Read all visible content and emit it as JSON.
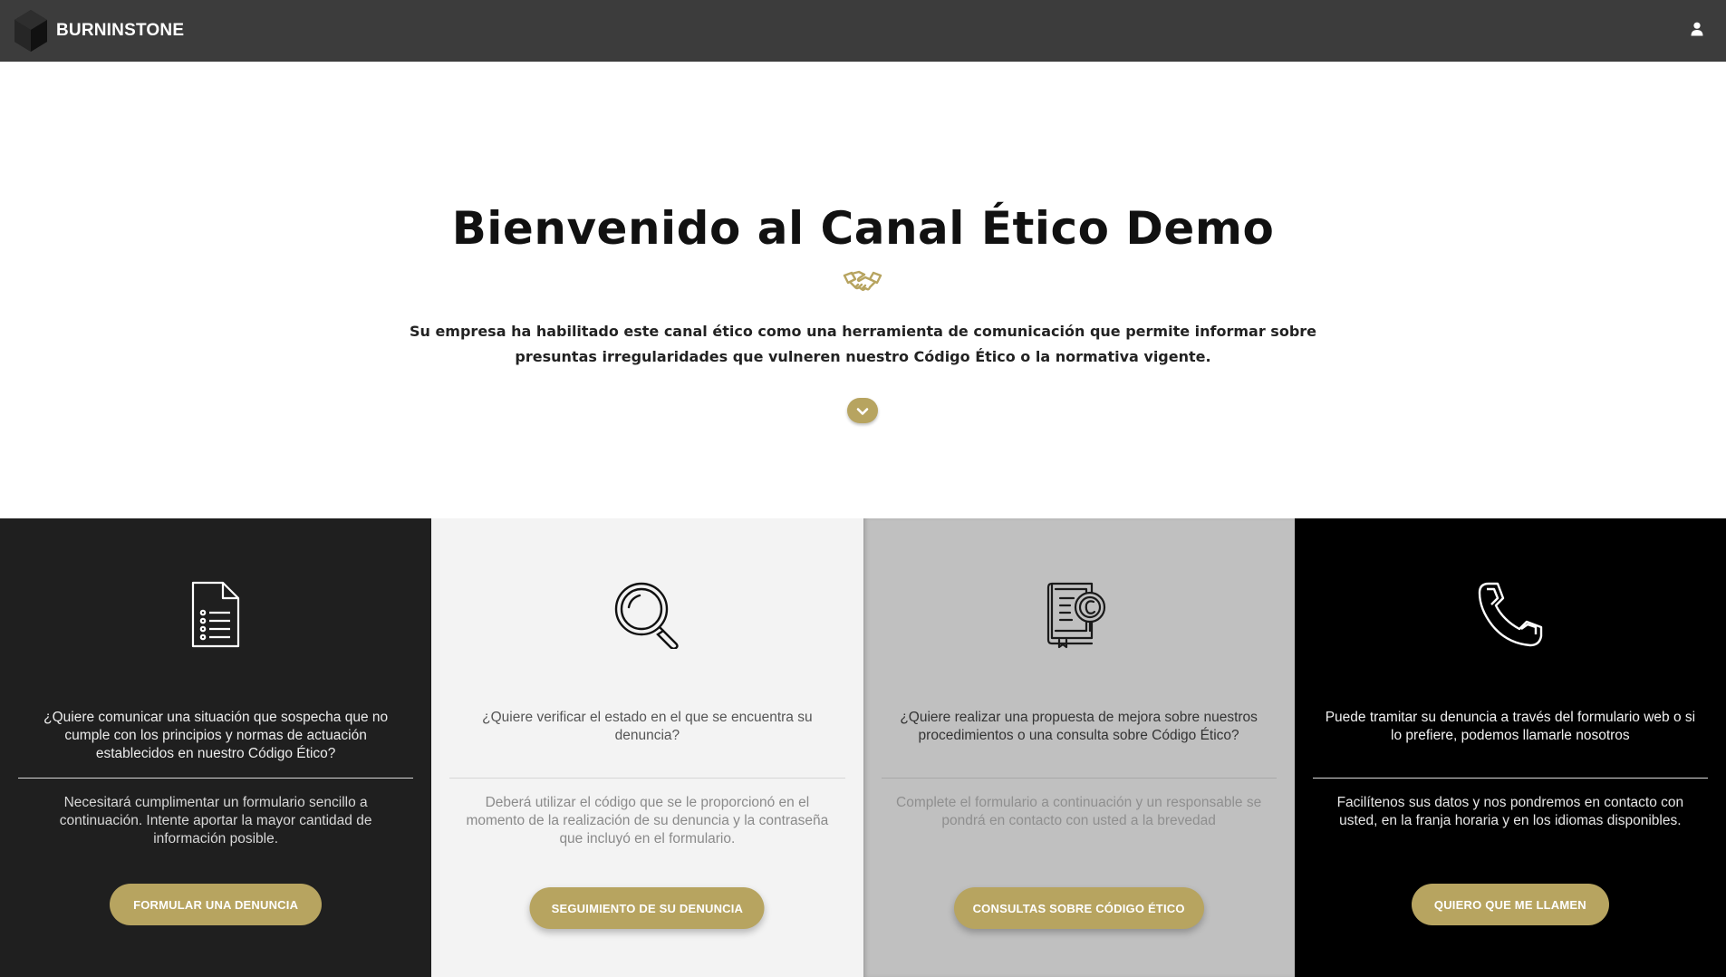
{
  "header": {
    "brand_name": "BURNINSTONE",
    "logo_icon": "hexagon-stone-logo",
    "user_icon": "user-icon"
  },
  "hero": {
    "title": "Bienvenido al Canal Ético Demo",
    "icon": "handshake-icon",
    "text": "Su empresa ha habilitado este canal ético como una herramienta de comunicación que permite informar sobre presuntas irregularidades que vulneren nuestro Código Ético o la normativa vigente.",
    "scroll_icon": "chevron-down-icon"
  },
  "cards": [
    {
      "icon": "document-list-icon",
      "question": "¿Quiere comunicar una situación que sospecha que no cumple con los principios y normas de actuación establecidos en nuestro Código Ético?",
      "description": "Necesitará cumplimentar un formulario sencillo a continuación. Intente aportar la mayor cantidad de información posible.",
      "button": "FORMULAR UNA DENUNCIA"
    },
    {
      "icon": "magnifier-icon",
      "question": "¿Quiere verificar el estado en el que se encuentra su denuncia?",
      "description": "Deberá utilizar el código que se le proporcionó en el momento de la realización de su denuncia y la contraseña que incluyó en el formulario.",
      "button": "SEGUIMIENTO DE SU DENUNCIA"
    },
    {
      "icon": "code-book-search-icon",
      "question": "¿Quiere realizar una propuesta de mejora sobre nuestros procedimientos o una consulta sobre Código Ético?",
      "description": "Complete el formulario a continuación y un responsable se pondrá en contacto con usted a la brevedad",
      "button": "CONSULTAS SOBRE CÓDIGO ÉTICO"
    },
    {
      "icon": "phone-icon",
      "question": "Puede tramitar su denuncia a través del formulario web o si lo prefiere, podemos llamarle nosotros",
      "description": "Facilítenos sus datos y nos pondremos en contacto con usted, en la franja horaria y en los idiomas disponibles.",
      "button": "QUIERO QUE ME LLAMEN"
    }
  ],
  "colors": {
    "topbar": "#3c3c3c",
    "accent_gold": "#b7a460",
    "card1_bg": "#1f1f1f",
    "card2_bg": "#f3f3f3",
    "card3_bg": "#c0c0c0",
    "card4_bg": "#000000"
  }
}
